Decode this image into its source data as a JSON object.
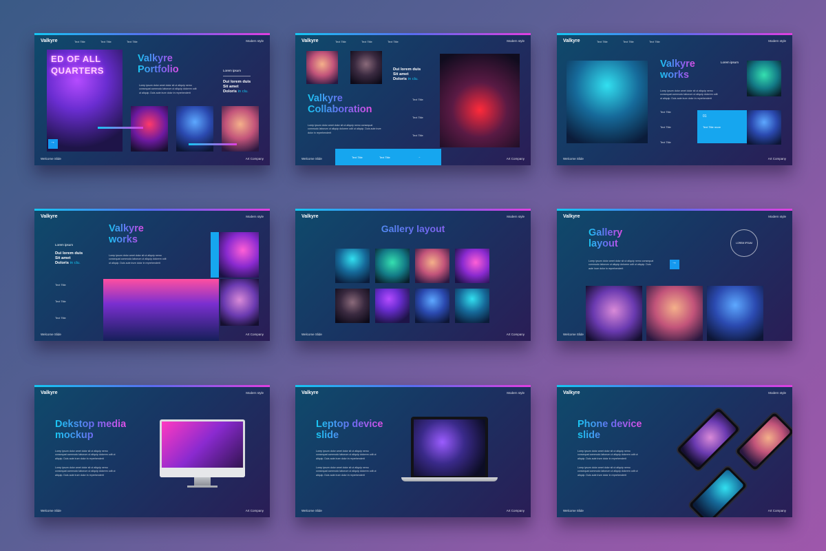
{
  "common": {
    "brand": "Valkyre",
    "tag": "Modern style",
    "footer_left": "Welcome Slide",
    "footer_right": "Art Company",
    "nav_title": "Text Title",
    "body_text": "Lorep ipsum dolor amet dolor sit ut aliquip nemo consequat commodo laborum ut aliquip dolorem odit ut aliquip. Duis aute irure dolor in reprehenderit",
    "lorem_label": "Lorem ipsum",
    "quote_a": "Dui lorem duis",
    "quote_b": "Sit amet",
    "quote_c": "Doloris",
    "quote_dim": "in clu."
  },
  "slides": {
    "s1": {
      "title_1": "Valkyre",
      "title_2": "Portfolio",
      "sign_1": "ED OF ALL",
      "sign_2": "QUARTERS"
    },
    "s2": {
      "title_1": "Valkyre",
      "title_2": "Collaboration"
    },
    "s3": {
      "title_1": "Valkyre",
      "title_2": "works",
      "card_title": "Text Title more"
    },
    "s4": {
      "title_1": "Valkyre",
      "title_2": "works"
    },
    "s5": {
      "title": "Gallery layout"
    },
    "s6": {
      "title_1": "Gallery",
      "title_2": "layout",
      "ring_label": "LOREM IPSUM"
    },
    "s7": {
      "title_1": "Dekstop media",
      "title_2": "mockup"
    },
    "s8": {
      "title_1": "Leptop device",
      "title_2": "slide"
    },
    "s9": {
      "title_1": "Phone device",
      "title_2": "slide"
    }
  }
}
